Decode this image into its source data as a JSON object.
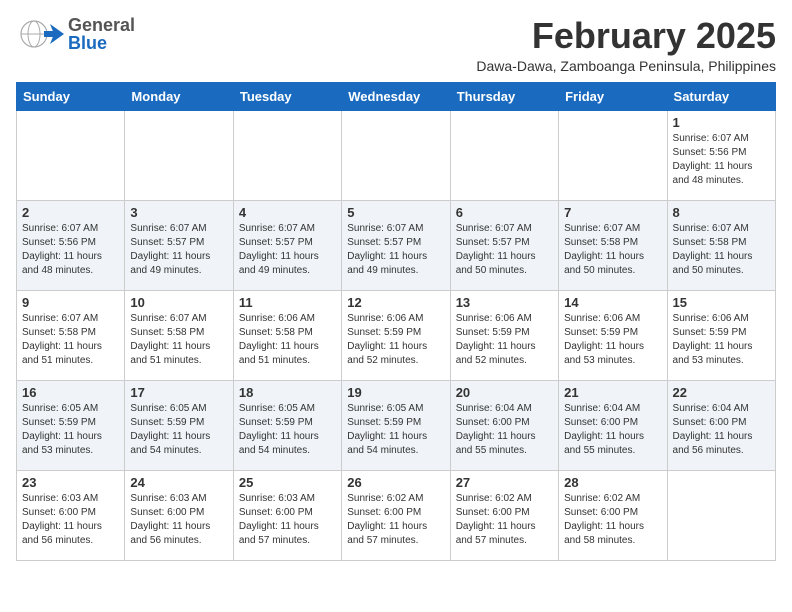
{
  "header": {
    "logo_general": "General",
    "logo_blue": "Blue",
    "month_title": "February 2025",
    "location": "Dawa-Dawa, Zamboanga Peninsula, Philippines"
  },
  "calendar": {
    "weekdays": [
      "Sunday",
      "Monday",
      "Tuesday",
      "Wednesday",
      "Thursday",
      "Friday",
      "Saturday"
    ],
    "weeks": [
      [
        {
          "day": "",
          "info": ""
        },
        {
          "day": "",
          "info": ""
        },
        {
          "day": "",
          "info": ""
        },
        {
          "day": "",
          "info": ""
        },
        {
          "day": "",
          "info": ""
        },
        {
          "day": "",
          "info": ""
        },
        {
          "day": "1",
          "info": "Sunrise: 6:07 AM\nSunset: 5:56 PM\nDaylight: 11 hours\nand 48 minutes."
        }
      ],
      [
        {
          "day": "2",
          "info": "Sunrise: 6:07 AM\nSunset: 5:56 PM\nDaylight: 11 hours\nand 48 minutes."
        },
        {
          "day": "3",
          "info": "Sunrise: 6:07 AM\nSunset: 5:57 PM\nDaylight: 11 hours\nand 49 minutes."
        },
        {
          "day": "4",
          "info": "Sunrise: 6:07 AM\nSunset: 5:57 PM\nDaylight: 11 hours\nand 49 minutes."
        },
        {
          "day": "5",
          "info": "Sunrise: 6:07 AM\nSunset: 5:57 PM\nDaylight: 11 hours\nand 49 minutes."
        },
        {
          "day": "6",
          "info": "Sunrise: 6:07 AM\nSunset: 5:57 PM\nDaylight: 11 hours\nand 50 minutes."
        },
        {
          "day": "7",
          "info": "Sunrise: 6:07 AM\nSunset: 5:58 PM\nDaylight: 11 hours\nand 50 minutes."
        },
        {
          "day": "8",
          "info": "Sunrise: 6:07 AM\nSunset: 5:58 PM\nDaylight: 11 hours\nand 50 minutes."
        }
      ],
      [
        {
          "day": "9",
          "info": "Sunrise: 6:07 AM\nSunset: 5:58 PM\nDaylight: 11 hours\nand 51 minutes."
        },
        {
          "day": "10",
          "info": "Sunrise: 6:07 AM\nSunset: 5:58 PM\nDaylight: 11 hours\nand 51 minutes."
        },
        {
          "day": "11",
          "info": "Sunrise: 6:06 AM\nSunset: 5:58 PM\nDaylight: 11 hours\nand 51 minutes."
        },
        {
          "day": "12",
          "info": "Sunrise: 6:06 AM\nSunset: 5:59 PM\nDaylight: 11 hours\nand 52 minutes."
        },
        {
          "day": "13",
          "info": "Sunrise: 6:06 AM\nSunset: 5:59 PM\nDaylight: 11 hours\nand 52 minutes."
        },
        {
          "day": "14",
          "info": "Sunrise: 6:06 AM\nSunset: 5:59 PM\nDaylight: 11 hours\nand 53 minutes."
        },
        {
          "day": "15",
          "info": "Sunrise: 6:06 AM\nSunset: 5:59 PM\nDaylight: 11 hours\nand 53 minutes."
        }
      ],
      [
        {
          "day": "16",
          "info": "Sunrise: 6:05 AM\nSunset: 5:59 PM\nDaylight: 11 hours\nand 53 minutes."
        },
        {
          "day": "17",
          "info": "Sunrise: 6:05 AM\nSunset: 5:59 PM\nDaylight: 11 hours\nand 54 minutes."
        },
        {
          "day": "18",
          "info": "Sunrise: 6:05 AM\nSunset: 5:59 PM\nDaylight: 11 hours\nand 54 minutes."
        },
        {
          "day": "19",
          "info": "Sunrise: 6:05 AM\nSunset: 5:59 PM\nDaylight: 11 hours\nand 54 minutes."
        },
        {
          "day": "20",
          "info": "Sunrise: 6:04 AM\nSunset: 6:00 PM\nDaylight: 11 hours\nand 55 minutes."
        },
        {
          "day": "21",
          "info": "Sunrise: 6:04 AM\nSunset: 6:00 PM\nDaylight: 11 hours\nand 55 minutes."
        },
        {
          "day": "22",
          "info": "Sunrise: 6:04 AM\nSunset: 6:00 PM\nDaylight: 11 hours\nand 56 minutes."
        }
      ],
      [
        {
          "day": "23",
          "info": "Sunrise: 6:03 AM\nSunset: 6:00 PM\nDaylight: 11 hours\nand 56 minutes."
        },
        {
          "day": "24",
          "info": "Sunrise: 6:03 AM\nSunset: 6:00 PM\nDaylight: 11 hours\nand 56 minutes."
        },
        {
          "day": "25",
          "info": "Sunrise: 6:03 AM\nSunset: 6:00 PM\nDaylight: 11 hours\nand 57 minutes."
        },
        {
          "day": "26",
          "info": "Sunrise: 6:02 AM\nSunset: 6:00 PM\nDaylight: 11 hours\nand 57 minutes."
        },
        {
          "day": "27",
          "info": "Sunrise: 6:02 AM\nSunset: 6:00 PM\nDaylight: 11 hours\nand 57 minutes."
        },
        {
          "day": "28",
          "info": "Sunrise: 6:02 AM\nSunset: 6:00 PM\nDaylight: 11 hours\nand 58 minutes."
        },
        {
          "day": "",
          "info": ""
        }
      ]
    ]
  }
}
